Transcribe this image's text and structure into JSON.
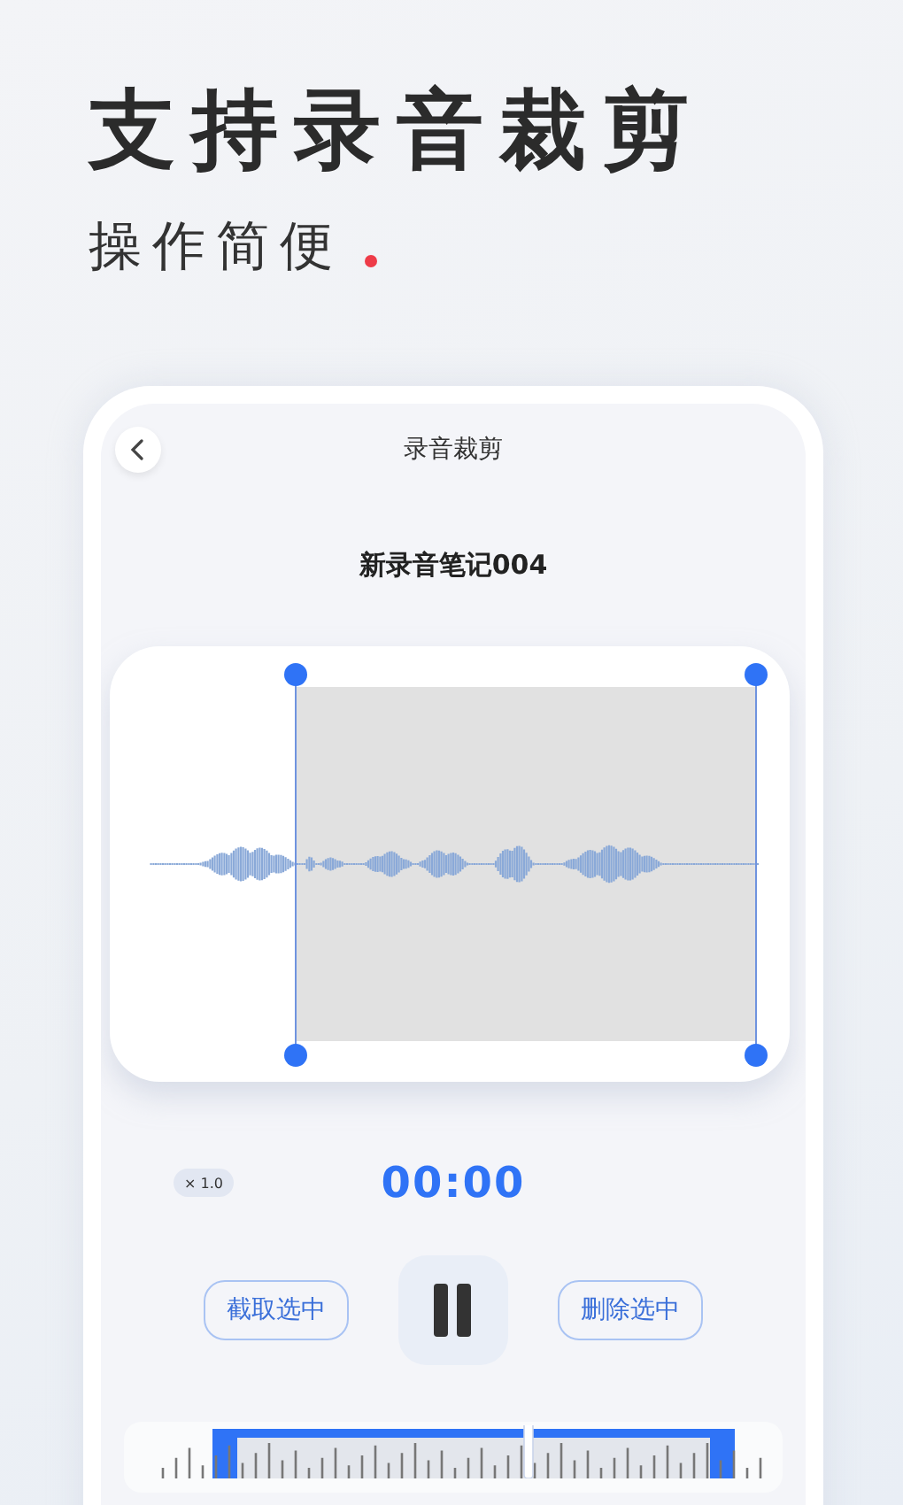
{
  "headline": "支持录音裁剪",
  "subtitle": "操作简便",
  "screen": {
    "title": "录音裁剪",
    "note_title": "新录音笔记004",
    "speed": "× 1.0",
    "time": "00:00",
    "buttons": [
      "截取选中",
      "删除选中"
    ]
  }
}
